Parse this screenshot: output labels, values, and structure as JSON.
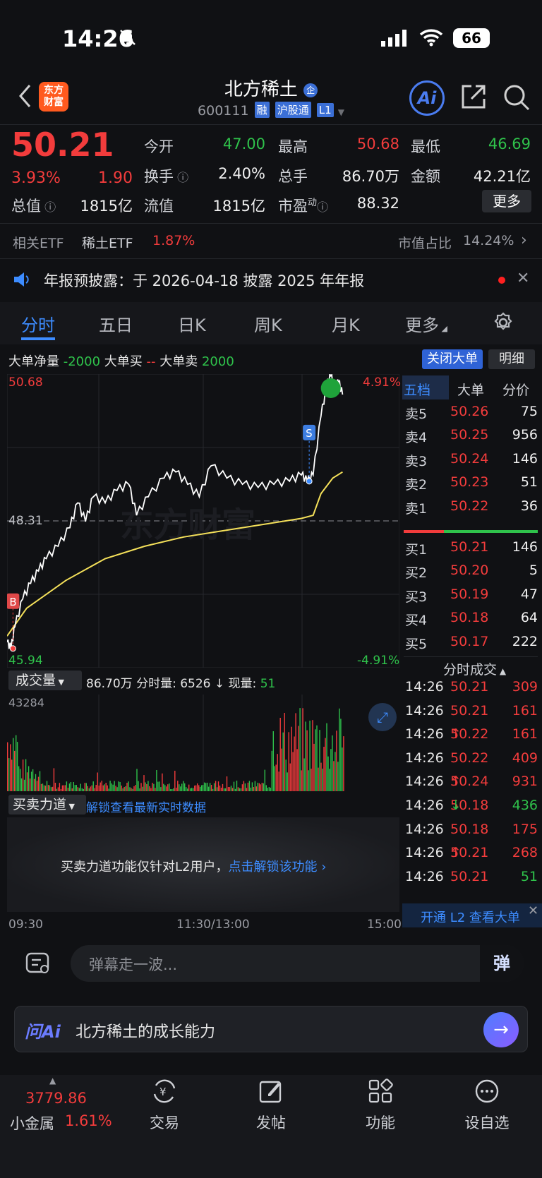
{
  "status": {
    "time": "14:26",
    "battery": "66"
  },
  "header": {
    "logo_line1": "东方",
    "logo_line2": "财富",
    "name": "北方稀土",
    "name_badge": "企",
    "code": "600111",
    "tag_margin": "融",
    "tag_connect": "沪股通",
    "tag_level": "L1",
    "ai_label": "Ai"
  },
  "quote": {
    "price": "50.21",
    "change_pct": "3.93%",
    "change": "1.90",
    "open_label": "今开",
    "open": "47.00",
    "high_label": "最高",
    "high": "50.68",
    "low_label": "最低",
    "low": "46.69",
    "turnover_label": "换手",
    "turnover": "2.40%",
    "volume_label": "总手",
    "volume": "86.70万",
    "amount_label": "金额",
    "amount": "42.21亿",
    "mktcap_label": "总值",
    "mktcap": "1815亿",
    "float_label": "流值",
    "float": "1815亿",
    "pe_label": "市盈",
    "pe_sup": "动",
    "pe": "88.32",
    "more": "更多"
  },
  "etf": {
    "label": "相关ETF",
    "name": "稀土ETF",
    "pct": "1.87%",
    "share_label": "市值占比",
    "share": "14.24%"
  },
  "notice": {
    "text": "年报预披露：于 2026-04-18 披露 2025 年年报"
  },
  "tabs": [
    "分时",
    "五日",
    "日K",
    "周K",
    "月K",
    "更多"
  ],
  "bigorder": {
    "net_label": "大单净量",
    "net": "-2000",
    "buy_label": "大单买",
    "buy": "--",
    "sell_label": "大单卖",
    "sell": "2000",
    "close_btn": "关闭大单",
    "detail_btn": "明细"
  },
  "chart_labels": {
    "top_price": "50.68",
    "top_pct": "4.91%",
    "mid_price": "48.31",
    "bottom_price": "45.94",
    "bottom_pct": "-4.91%",
    "marker_b": "B",
    "marker_s": "S",
    "watermark": "东方财富"
  },
  "volume": {
    "selector": "成交量",
    "total": "86.70万",
    "minute_label": "分时量:",
    "minute": "6526",
    "arrow": "↓",
    "now_label": "现量:",
    "now": "51",
    "max": "43284"
  },
  "power": {
    "selector": "买卖力道",
    "unlock": "解锁查看最新实时数据",
    "msg": "买卖力道功能仅针对L2用户，",
    "msg_link": "点击解锁该功能"
  },
  "time_axis": {
    "start": "09:30",
    "mid": "11:30/13:00",
    "end": "15:00"
  },
  "orderbook": {
    "tabs": [
      "五档",
      "大单",
      "分价"
    ],
    "asks": [
      {
        "label": "卖5",
        "price": "50.26",
        "vol": "75"
      },
      {
        "label": "卖4",
        "price": "50.25",
        "vol": "956"
      },
      {
        "label": "卖3",
        "price": "50.24",
        "vol": "146"
      },
      {
        "label": "卖2",
        "price": "50.23",
        "vol": "51"
      },
      {
        "label": "卖1",
        "price": "50.22",
        "vol": "36"
      }
    ],
    "bids": [
      {
        "label": "买1",
        "price": "50.21",
        "vol": "146"
      },
      {
        "label": "买2",
        "price": "50.20",
        "vol": "5"
      },
      {
        "label": "买3",
        "price": "50.19",
        "vol": "47"
      },
      {
        "label": "买4",
        "price": "50.18",
        "vol": "64"
      },
      {
        "label": "买5",
        "price": "50.17",
        "vol": "222"
      }
    ],
    "trades_title": "分时成交",
    "trades": [
      {
        "time": "14:26",
        "price": "50.21",
        "dir": "",
        "vol": "309",
        "color": "red"
      },
      {
        "time": "14:26",
        "price": "50.21",
        "dir": "",
        "vol": "161",
        "color": "red"
      },
      {
        "time": "14:26",
        "price": "50.22",
        "dir": "↑",
        "vol": "161",
        "color": "red"
      },
      {
        "time": "14:26",
        "price": "50.22",
        "dir": "",
        "vol": "409",
        "color": "red"
      },
      {
        "time": "14:26",
        "price": "50.24",
        "dir": "↑",
        "vol": "931",
        "color": "red"
      },
      {
        "time": "14:26",
        "price": "50.18",
        "dir": "↓",
        "vol": "436",
        "color": "green"
      },
      {
        "time": "14:26",
        "price": "50.18",
        "dir": "",
        "vol": "175",
        "color": "red"
      },
      {
        "time": "14:26",
        "price": "50.21",
        "dir": "↑",
        "vol": "268",
        "color": "red"
      },
      {
        "time": "14:26",
        "price": "50.21",
        "dir": "",
        "vol": "51",
        "color": "green"
      }
    ],
    "l2_banner": "开通 L2 查看大单"
  },
  "danmu": {
    "placeholder": "弹幕走一波...",
    "btn": "弹"
  },
  "ai_ask": {
    "logo": "问Ai",
    "text": "北方稀土的成长能力"
  },
  "bottom_nav": {
    "index_value": "3779.86",
    "index_name": "小金属",
    "index_pct": "1.61%",
    "items": [
      "交易",
      "发帖",
      "功能",
      "设自选"
    ]
  },
  "colors": {
    "up": "#f23c3c",
    "down": "#2fc24b",
    "accent": "#3d8cff",
    "price_line": "#ffffff",
    "avg_line": "#f5e15a"
  }
}
